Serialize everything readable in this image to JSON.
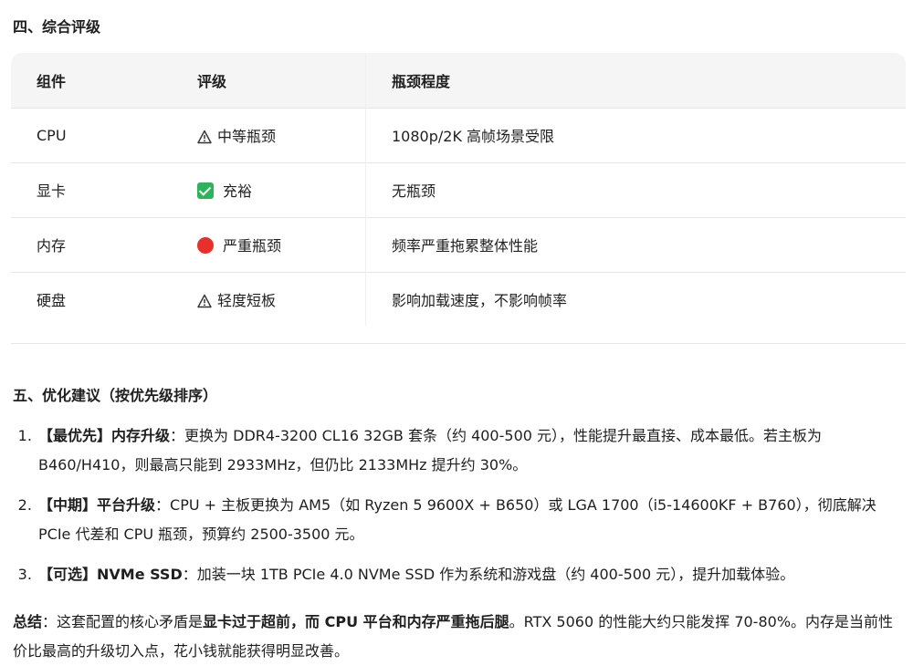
{
  "section4": {
    "title": "四、综合评级",
    "table": {
      "headers": [
        "组件",
        "评级",
        "瓶颈程度"
      ],
      "rows": [
        {
          "component": "CPU",
          "rating_icon": "warning-icon",
          "rating": "中等瓶颈",
          "bottleneck": "1080p/2K 高帧场景受限"
        },
        {
          "component": "显卡",
          "rating_icon": "check-icon",
          "rating": "充裕",
          "bottleneck": "无瓶颈"
        },
        {
          "component": "内存",
          "rating_icon": "red-dot-icon",
          "rating": "严重瓶颈",
          "bottleneck": "频率严重拖累整体性能"
        },
        {
          "component": "硬盘",
          "rating_icon": "warning-icon",
          "rating": "轻度短板",
          "bottleneck": "影响加载速度，不影响帧率"
        }
      ]
    }
  },
  "section5": {
    "title": "五、优化建议（按优先级排序）",
    "items": [
      {
        "tag": "【最优先】内存升级",
        "sep": "：",
        "text": "更换为 DDR4-3200 CL16 32GB 套条（约 400-500 元），性能提升最直接、成本最低。若主板为 B460/H410，则最高只能到 2933MHz，但仍比 2133MHz 提升约 30%。"
      },
      {
        "tag": "【中期】平台升级",
        "sep": "：",
        "text": "CPU + 主板更换为 AM5（如 Ryzen 5 9600X + B650）或 LGA 1700（i5-14600KF + B760），彻底解决 PCIe 代差和 CPU 瓶颈，预算约 2500-3500 元。"
      },
      {
        "tag": "【可选】NVMe SSD",
        "sep": "：",
        "text": "加装一块 1TB PCIe 4.0 NVMe SSD 作为系统和游戏盘（约 400-500 元），提升加载体验。"
      }
    ]
  },
  "summary": {
    "label": "总结",
    "sep": "：",
    "text1": "这套配置的核心矛盾是",
    "bold": "显卡过于超前，而 CPU 平台和内存严重拖后腿",
    "text2": "。RTX 5060 的性能大约只能发挥 70-80%。内存是当前性价比最高的升级切入点，花小钱就能获得明显改善。"
  },
  "colors": {
    "check": "#2fb35a",
    "red_dot": "#e8302a",
    "header_bg": "#f5f5f5"
  }
}
